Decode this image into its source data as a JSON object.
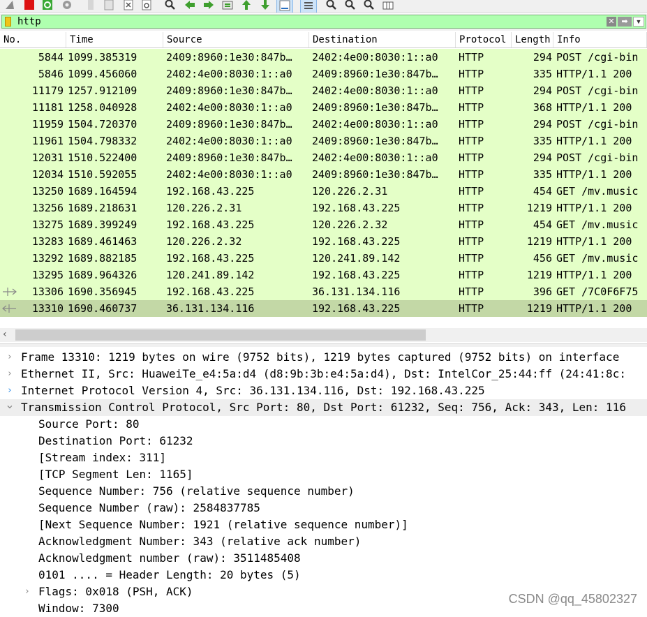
{
  "toolbar": {
    "icons": [
      "shark-fin-icon",
      "stop-capture-icon",
      "restart-capture-icon",
      "capture-options-icon",
      "open-file-icon",
      "save-file-icon",
      "close-file-icon",
      "reload-icon",
      "find-icon",
      "back-icon",
      "forward-icon",
      "go-to-packet-icon",
      "first-packet-icon",
      "last-packet-icon",
      "autoscroll-icon",
      "colorize-icon",
      "zoom-in-icon",
      "zoom-out-icon",
      "normal-size-icon",
      "resize-columns-icon"
    ]
  },
  "filter": {
    "value": "http"
  },
  "packet_list": {
    "columns": [
      "No.",
      "Time",
      "Source",
      "Destination",
      "Protocol",
      "Length",
      "Info"
    ],
    "rows": [
      {
        "no": "5844",
        "time": "1099.385319",
        "src": "2409:8960:1e30:847b…",
        "dst": "2402:4e00:8030:1::a0",
        "proto": "HTTP",
        "len": "294",
        "info": "POST /cgi-bin"
      },
      {
        "no": "5846",
        "time": "1099.456060",
        "src": "2402:4e00:8030:1::a0",
        "dst": "2409:8960:1e30:847b…",
        "proto": "HTTP",
        "len": "335",
        "info": "HTTP/1.1 200"
      },
      {
        "no": "11179",
        "time": "1257.912109",
        "src": "2409:8960:1e30:847b…",
        "dst": "2402:4e00:8030:1::a0",
        "proto": "HTTP",
        "len": "294",
        "info": "POST /cgi-bin"
      },
      {
        "no": "11181",
        "time": "1258.040928",
        "src": "2402:4e00:8030:1::a0",
        "dst": "2409:8960:1e30:847b…",
        "proto": "HTTP",
        "len": "368",
        "info": "HTTP/1.1 200"
      },
      {
        "no": "11959",
        "time": "1504.720370",
        "src": "2409:8960:1e30:847b…",
        "dst": "2402:4e00:8030:1::a0",
        "proto": "HTTP",
        "len": "294",
        "info": "POST /cgi-bin"
      },
      {
        "no": "11961",
        "time": "1504.798332",
        "src": "2402:4e00:8030:1::a0",
        "dst": "2409:8960:1e30:847b…",
        "proto": "HTTP",
        "len": "335",
        "info": "HTTP/1.1 200"
      },
      {
        "no": "12031",
        "time": "1510.522400",
        "src": "2409:8960:1e30:847b…",
        "dst": "2402:4e00:8030:1::a0",
        "proto": "HTTP",
        "len": "294",
        "info": "POST /cgi-bin"
      },
      {
        "no": "12034",
        "time": "1510.592055",
        "src": "2402:4e00:8030:1::a0",
        "dst": "2409:8960:1e30:847b…",
        "proto": "HTTP",
        "len": "335",
        "info": "HTTP/1.1 200"
      },
      {
        "no": "13250",
        "time": "1689.164594",
        "src": "192.168.43.225",
        "dst": "120.226.2.31",
        "proto": "HTTP",
        "len": "454",
        "info": "GET /mv.music"
      },
      {
        "no": "13256",
        "time": "1689.218631",
        "src": "120.226.2.31",
        "dst": "192.168.43.225",
        "proto": "HTTP",
        "len": "1219",
        "info": "HTTP/1.1 200"
      },
      {
        "no": "13275",
        "time": "1689.399249",
        "src": "192.168.43.225",
        "dst": "120.226.2.32",
        "proto": "HTTP",
        "len": "454",
        "info": "GET /mv.music"
      },
      {
        "no": "13283",
        "time": "1689.461463",
        "src": "120.226.2.32",
        "dst": "192.168.43.225",
        "proto": "HTTP",
        "len": "1219",
        "info": "HTTP/1.1 200"
      },
      {
        "no": "13292",
        "time": "1689.882185",
        "src": "192.168.43.225",
        "dst": "120.241.89.142",
        "proto": "HTTP",
        "len": "456",
        "info": "GET /mv.music"
      },
      {
        "no": "13295",
        "time": "1689.964326",
        "src": "120.241.89.142",
        "dst": "192.168.43.225",
        "proto": "HTTP",
        "len": "1219",
        "info": "HTTP/1.1 200"
      },
      {
        "no": "13306",
        "time": "1690.356945",
        "src": "192.168.43.225",
        "dst": "36.131.134.116",
        "proto": "HTTP",
        "len": "396",
        "info": "GET /7C0F6F75",
        "rel": "request"
      },
      {
        "no": "13310",
        "time": "1690.460737",
        "src": "36.131.134.116",
        "dst": "192.168.43.225",
        "proto": "HTTP",
        "len": "1219",
        "info": "HTTP/1.1 200",
        "rel": "response",
        "selected": true
      }
    ]
  },
  "details": [
    {
      "text": "Frame 13310: 1219 bytes on wire (9752 bits), 1219 bytes captured (9752 bits) on interface",
      "level": 0,
      "chevron": "collapsed"
    },
    {
      "text": "Ethernet II, Src: HuaweiTe_e4:5a:d4 (d8:9b:3b:e4:5a:d4), Dst: IntelCor_25:44:ff (24:41:8c:",
      "level": 0,
      "chevron": "collapsed"
    },
    {
      "text": "Internet Protocol Version 4, Src: 36.131.134.116, Dst: 192.168.43.225",
      "level": 0,
      "chevron": "collapsed-blue"
    },
    {
      "text": "Transmission Control Protocol, Src Port: 80, Dst Port: 61232, Seq: 756, Ack: 343, Len: 116",
      "level": 0,
      "chevron": "expanded",
      "highlight": true
    },
    {
      "text": "Source Port: 80",
      "level": 1
    },
    {
      "text": "Destination Port: 61232",
      "level": 1
    },
    {
      "text": "[Stream index: 311]",
      "level": 1
    },
    {
      "text": "[TCP Segment Len: 1165]",
      "level": 1
    },
    {
      "text": "Sequence Number: 756    (relative sequence number)",
      "level": 1
    },
    {
      "text": "Sequence Number (raw): 2584837785",
      "level": 1
    },
    {
      "text": "[Next Sequence Number: 1921    (relative sequence number)]",
      "level": 1
    },
    {
      "text": "Acknowledgment Number: 343    (relative ack number)",
      "level": 1
    },
    {
      "text": "Acknowledgment number (raw): 3511485408",
      "level": 1
    },
    {
      "text": "0101 .... = Header Length: 20 bytes (5)",
      "level": 1
    },
    {
      "text": "Flags: 0x018 (PSH, ACK)",
      "level": 1,
      "chevron": "collapsed"
    },
    {
      "text": "Window: 7300",
      "level": 1
    }
  ],
  "watermark": "CSDN @qq_45802327",
  "colors": {
    "row_bg": "#e4ffc7",
    "row_selected": "#c3d8a6",
    "filter_bg": "#afffaf",
    "tree_highlight": "#eeeeee"
  }
}
